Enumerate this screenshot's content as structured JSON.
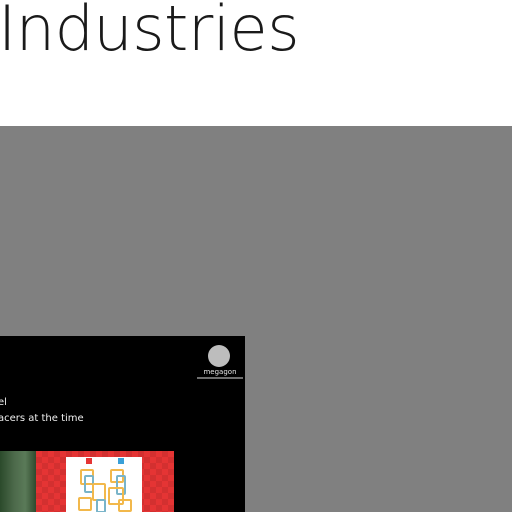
{
  "header": {
    "title": "Industries"
  },
  "video": {
    "logo_name": "megagon",
    "caption_lines": [
      "el",
      "acers at the time"
    ]
  },
  "colors": {
    "gray_bg": "#808080",
    "video_bg": "#000000",
    "accent_red": "#e53434"
  }
}
